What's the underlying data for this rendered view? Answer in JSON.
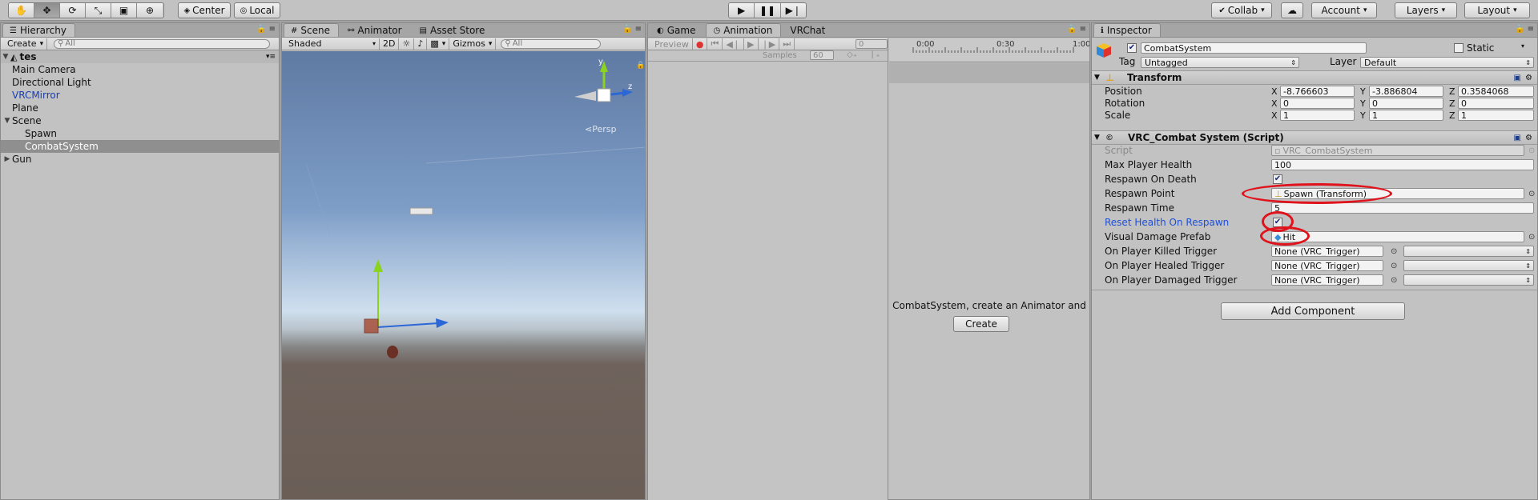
{
  "toolbar": {
    "pivot_label": "Center",
    "space_label": "Local",
    "collab_label": "Collab",
    "account_label": "Account",
    "layers_label": "Layers",
    "layout_label": "Layout"
  },
  "hierarchy": {
    "tab": "Hierarchy",
    "create_label": "Create",
    "search_placeholder": "All",
    "scene_name": "tes",
    "items": [
      {
        "label": "Main Camera",
        "depth": 1
      },
      {
        "label": "Directional Light",
        "depth": 1
      },
      {
        "label": "VRCMirror",
        "depth": 1,
        "prefab": true
      },
      {
        "label": "Plane",
        "depth": 1
      },
      {
        "label": "Scene",
        "depth": 1,
        "expanded": true
      },
      {
        "label": "Spawn",
        "depth": 2
      },
      {
        "label": "CombatSystem",
        "depth": 2,
        "selected": true
      },
      {
        "label": "Gun",
        "depth": 1,
        "collapsed": true
      }
    ]
  },
  "scene": {
    "tabs": [
      "Scene",
      "Animator",
      "Asset Store"
    ],
    "shading": "Shaded",
    "mode_2d": "2D",
    "gizmos": "Gizmos",
    "search_placeholder": "All",
    "gizmo_y": "y",
    "gizmo_z": "z",
    "persp": "Persp"
  },
  "animation": {
    "tabs": [
      "Game",
      "Animation",
      "VRChat"
    ],
    "preview": "Preview",
    "frame": "0",
    "samples_label": "Samples",
    "samples_value": "60",
    "ruler": [
      "0:00",
      "0:30",
      "1:00"
    ],
    "message": "CombatSystem, create an Animator and",
    "create_button": "Create"
  },
  "inspector": {
    "tab": "Inspector",
    "object_name": "CombatSystem",
    "static_label": "Static",
    "tag_label": "Tag",
    "tag_value": "Untagged",
    "layer_label": "Layer",
    "layer_value": "Default",
    "transform": {
      "title": "Transform",
      "rows": [
        {
          "label": "Position",
          "x": "-8.766603",
          "y": "-3.886804",
          "z": "0.3584068"
        },
        {
          "label": "Rotation",
          "x": "0",
          "y": "0",
          "z": "0"
        },
        {
          "label": "Scale",
          "x": "1",
          "y": "1",
          "z": "1"
        }
      ]
    },
    "script": {
      "title": "VRC_Combat System (Script)",
      "script_label": "Script",
      "script_value": "VRC_CombatSystem",
      "max_health_label": "Max Player Health",
      "max_health_value": "100",
      "respawn_on_death_label": "Respawn On Death",
      "respawn_point_label": "Respawn Point",
      "respawn_point_value": "Spawn (Transform)",
      "respawn_time_label": "Respawn Time",
      "respawn_time_value": "5",
      "reset_health_label": "Reset Health On Respawn",
      "visual_damage_label": "Visual Damage Prefab",
      "visual_damage_value": "Hit",
      "killed_label": "On Player Killed Trigger",
      "healed_label": "On Player Healed Trigger",
      "damaged_label": "On Player Damaged Trigger",
      "trigger_value": "None (VRC_Trigger)"
    },
    "add_component": "Add Component"
  },
  "colors": {
    "highlight_ring": "#e0121b",
    "prefab_text": "#1b3eaf",
    "link_text": "#1f4fd6"
  }
}
